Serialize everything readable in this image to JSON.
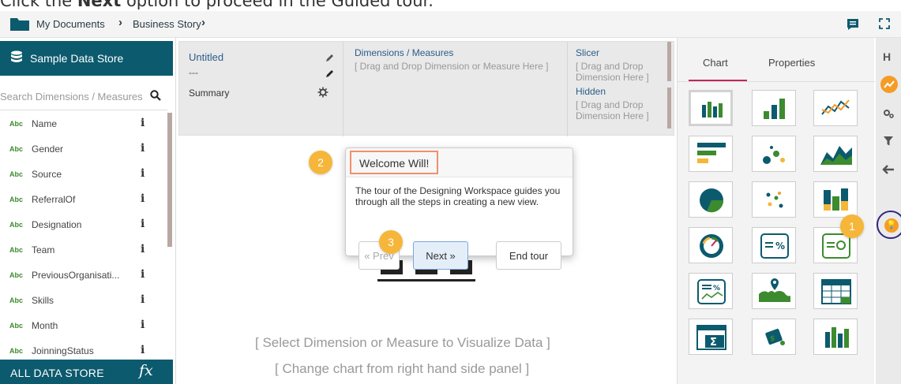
{
  "caption": {
    "before": "Click the ",
    "bold": "Next",
    "after": " option to proceed in the Guided tour."
  },
  "breadcrumb": {
    "items": [
      "My Documents",
      "Business Story"
    ],
    "separator": "›"
  },
  "left_panel": {
    "header_label": "Sample Data Store",
    "search_placeholder": "Search Dimensions / Measures",
    "type_tag": "Abc",
    "info_symbol": "i",
    "fields": [
      "Name",
      "Gender",
      "Source",
      "ReferralOf",
      "Designation",
      "Team",
      "PreviousOrganisati...",
      "Skills",
      "Month",
      "JoinningStatus"
    ],
    "footer_label": "ALL DATA STORE",
    "fx_label": "fx"
  },
  "config": {
    "title": "Untitled",
    "dash": "---",
    "summary": "Summary",
    "dimensions_header": "Dimensions / Measures",
    "dimensions_hint": "[ Drag and Drop Dimension or Measure Here ]",
    "slicer_header": "Slicer",
    "slicer_hint": "[ Drag and Drop Dimension Here ]",
    "hidden_header": "Hidden",
    "hidden_hint": "[ Drag and Drop Dimension Here ]"
  },
  "canvas": {
    "placeholder_primary": "[ Select Dimension or Measure to Visualize Data ]",
    "placeholder_secondary": "[ Change chart from right hand side panel ]"
  },
  "tour": {
    "title": "Welcome Will!",
    "body": "The tour of the Designing Workspace guides you through all the steps in creating a new view.",
    "prev_label": "« Prev",
    "next_label": "Next »",
    "end_label": "End tour"
  },
  "badges": [
    "1",
    "2",
    "3"
  ],
  "right_panel": {
    "tabs": [
      "Chart",
      "Properties"
    ],
    "active_tab": "Chart"
  },
  "colors": {
    "brand_teal": "#0c5a6e",
    "badge_orange": "#f5b63a",
    "active_tab_underline": "#c0265c",
    "highlight_border": "#f0906b"
  }
}
